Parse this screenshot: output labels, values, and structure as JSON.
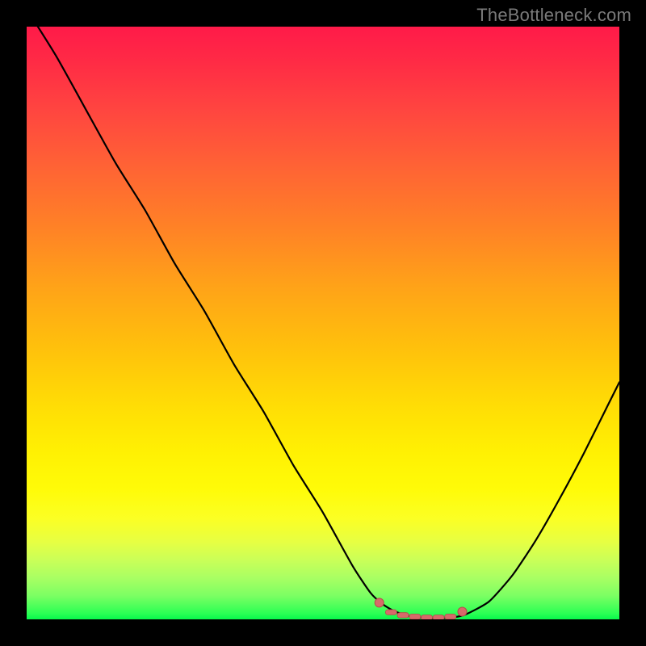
{
  "watermark": "TheBottleneck.com",
  "colors": {
    "frame": "#000000",
    "curve": "#000000",
    "marker": "#d66a6a",
    "marker_outline": "#b84a4a"
  },
  "chart_data": {
    "type": "line",
    "title": "",
    "xlabel": "",
    "ylabel": "",
    "xlim": [
      0,
      100
    ],
    "ylim": [
      0,
      100
    ],
    "grid": false,
    "series": [
      {
        "name": "bottleneck-curve",
        "x": [
          0,
          5,
          10,
          15,
          20,
          25,
          30,
          35,
          40,
          45,
          50,
          55,
          58,
          60,
          62,
          64,
          66,
          68,
          70,
          72,
          74,
          78,
          82,
          86,
          90,
          94,
          98,
          100
        ],
        "y": [
          103,
          95,
          86,
          77,
          69,
          60,
          52,
          43,
          35,
          26,
          18,
          9,
          4.5,
          2.6,
          1.4,
          0.7,
          0.35,
          0.2,
          0.2,
          0.35,
          0.8,
          3.0,
          7.5,
          13.5,
          20.5,
          28.0,
          36.0,
          40.0
        ]
      }
    ],
    "markers": [
      {
        "name": "flat-left-end",
        "x": 59.5,
        "y": 2.8
      },
      {
        "name": "flat-seg-1",
        "x": 61.5,
        "y": 1.2
      },
      {
        "name": "flat-seg-2",
        "x": 63.5,
        "y": 0.7
      },
      {
        "name": "flat-seg-3",
        "x": 65.5,
        "y": 0.45
      },
      {
        "name": "flat-seg-4",
        "x": 67.5,
        "y": 0.3
      },
      {
        "name": "flat-seg-5",
        "x": 69.5,
        "y": 0.3
      },
      {
        "name": "flat-seg-6",
        "x": 71.5,
        "y": 0.45
      },
      {
        "name": "flat-right-end",
        "x": 73.5,
        "y": 1.3
      }
    ]
  }
}
